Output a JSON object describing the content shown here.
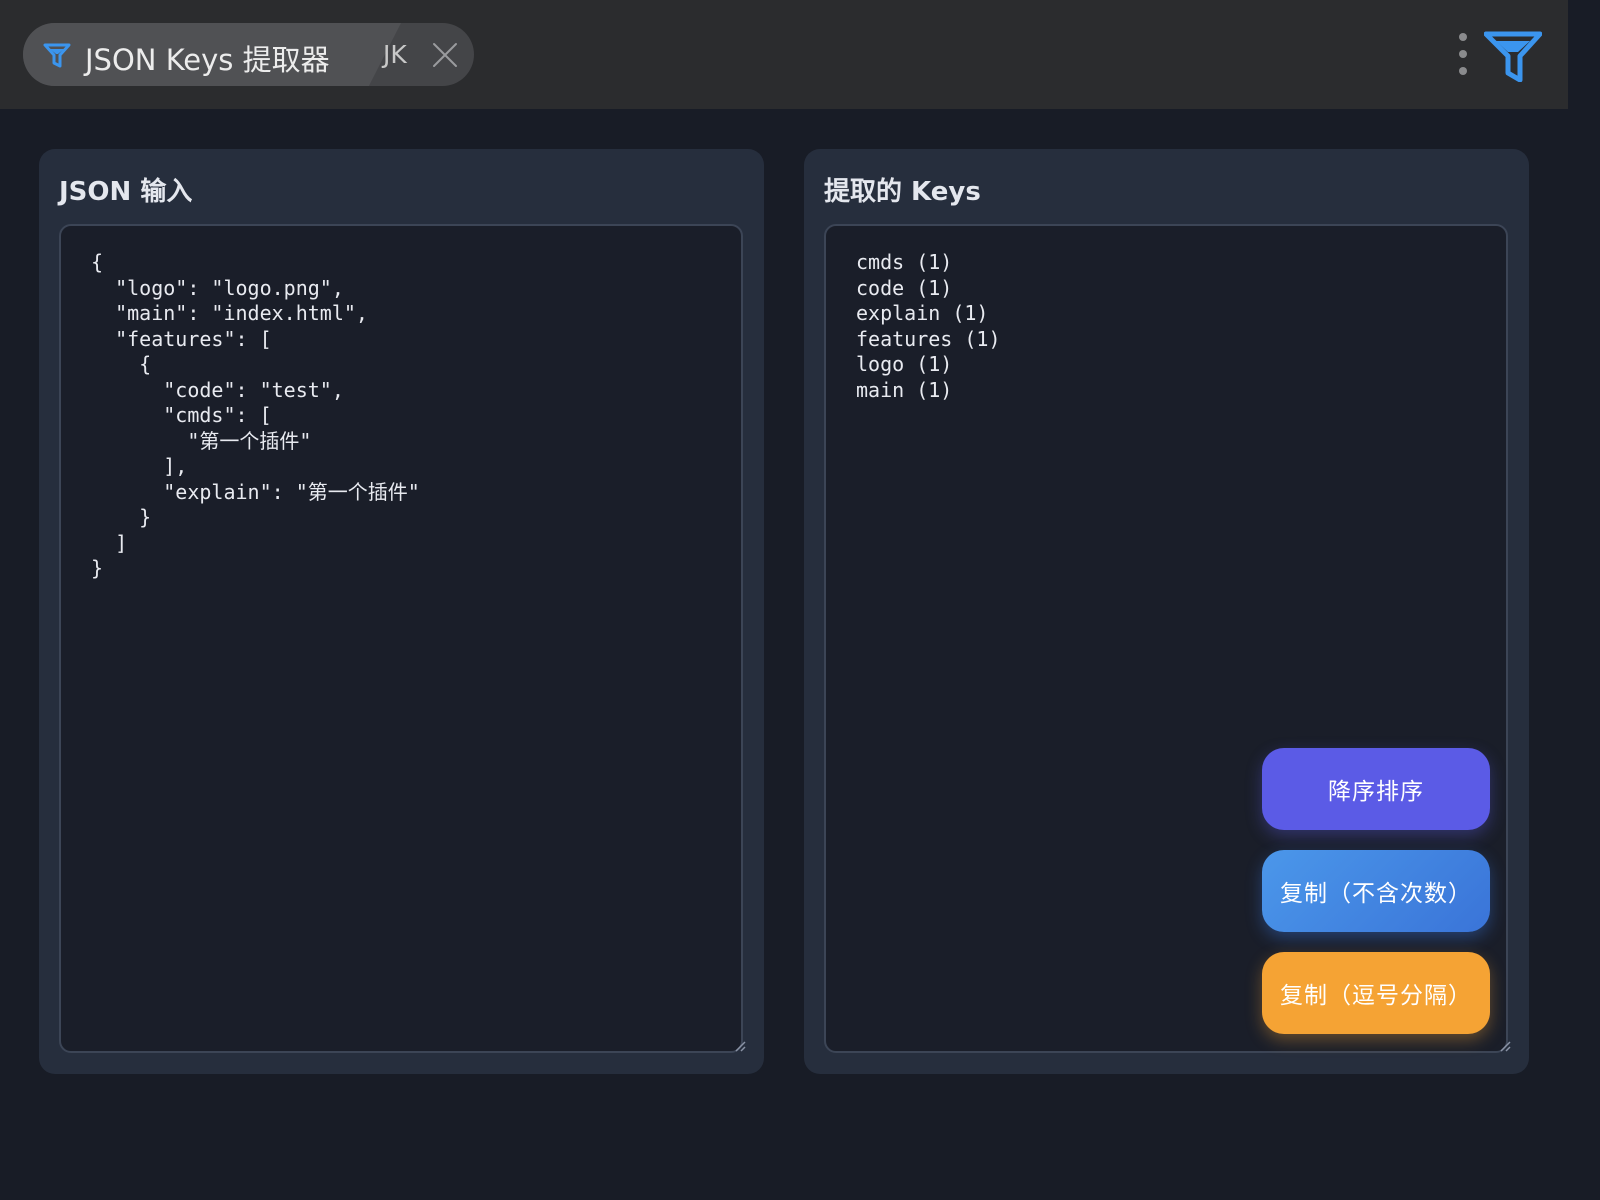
{
  "tab": {
    "title": "JSON Keys 提取器",
    "short": "JK",
    "icon": "filter-icon",
    "close_icon": "close-icon"
  },
  "titlebar": {
    "menu_icon": "more-vertical-icon",
    "logo_icon": "filter-logo-icon"
  },
  "colors": {
    "accent_blue": "#3b95ee",
    "sort_button": "#5b5be6",
    "copy_plain_button": "#4b97ea",
    "copy_comma_button": "#f5a334"
  },
  "input_panel": {
    "title": "JSON 输入",
    "content": "{\n  \"logo\": \"logo.png\",\n  \"main\": \"index.html\",\n  \"features\": [\n    {\n      \"code\": \"test\",\n      \"cmds\": [\n        \"第一个插件\"\n      ],\n      \"explain\": \"第一个插件\"\n    }\n  ]\n}"
  },
  "output_panel": {
    "title": "提取的 Keys",
    "content": "cmds (1)\ncode (1)\nexplain (1)\nfeatures (1)\nlogo (1)\nmain (1)"
  },
  "buttons": {
    "sort_desc": "降序排序",
    "copy_plain": "复制（不含次数）",
    "copy_comma": "复制（逗号分隔）"
  }
}
